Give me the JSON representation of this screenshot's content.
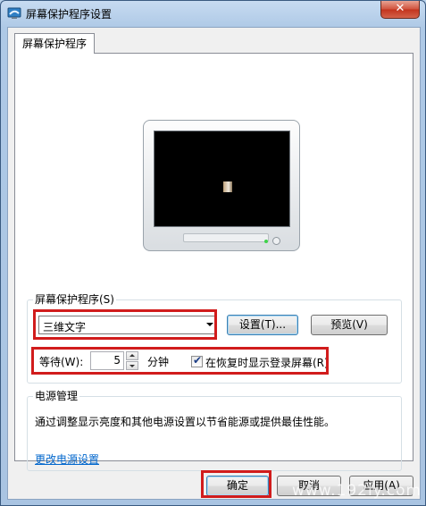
{
  "window": {
    "title": "屏幕保护程序设置",
    "close_label": "✕"
  },
  "tab": {
    "label": "屏幕保护程序"
  },
  "screensaver": {
    "group_label": "屏幕保护程序(S)",
    "selected": "三维文字",
    "settings_label": "设置(T)...",
    "preview_label": "预览(V)",
    "wait_label": "等待(W):",
    "wait_value": "5",
    "wait_unit": "分钟",
    "resume_checked": true,
    "resume_label": "在恢复时显示登录屏幕(R)"
  },
  "power": {
    "group_label": "电源管理",
    "description": "通过调整显示亮度和其他电源设置以节省能源或提供最佳性能。",
    "link": "更改电源设置"
  },
  "buttons": {
    "ok": "确定",
    "cancel": "取消",
    "apply": "应用(A)"
  },
  "watermark": "www.192ly.com",
  "colors": {
    "highlight": "#d11c1c",
    "link": "#0066cc"
  }
}
